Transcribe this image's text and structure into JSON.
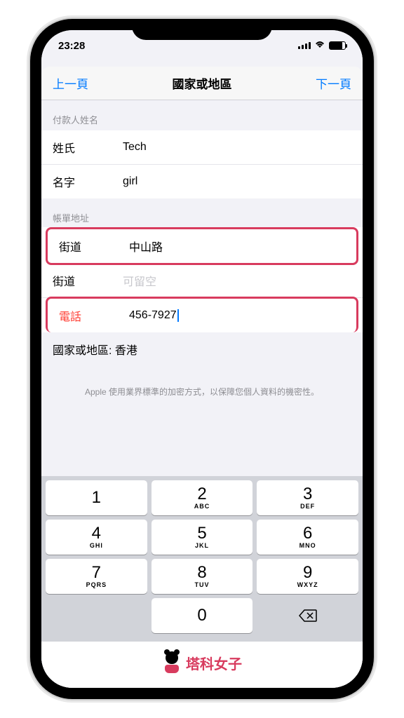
{
  "status": {
    "time": "23:28"
  },
  "nav": {
    "back": "上一頁",
    "title": "國家或地區",
    "next": "下一頁"
  },
  "sections": {
    "payer": {
      "header": "付款人姓名",
      "lastname_label": "姓氏",
      "lastname_value": "Tech",
      "firstname_label": "名字",
      "firstname_value": "girl"
    },
    "billing": {
      "header": "帳單地址",
      "street1_label": "街道",
      "street1_value": "中山路",
      "street2_label": "街道",
      "street2_placeholder": "可留空",
      "phone_label": "電話",
      "phone_value": "456-7927",
      "region": "國家或地區: 香港"
    }
  },
  "footer": "Apple 使用業界標準的加密方式，以保障您個人資料的機密性。",
  "keypad": [
    [
      {
        "n": "1",
        "l": ""
      },
      {
        "n": "2",
        "l": "ABC"
      },
      {
        "n": "3",
        "l": "DEF"
      }
    ],
    [
      {
        "n": "4",
        "l": "GHI"
      },
      {
        "n": "5",
        "l": "JKL"
      },
      {
        "n": "6",
        "l": "MNO"
      }
    ],
    [
      {
        "n": "7",
        "l": "PQRS"
      },
      {
        "n": "8",
        "l": "TUV"
      },
      {
        "n": "9",
        "l": "WXYZ"
      }
    ]
  ],
  "keypad_zero": "0",
  "logo": "塔科女子"
}
